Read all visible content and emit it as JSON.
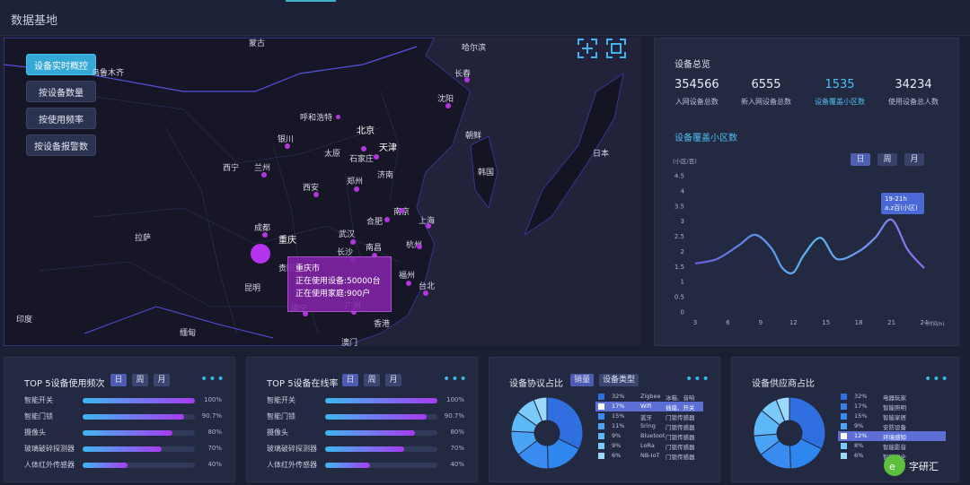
{
  "header": {
    "title": "数据基地"
  },
  "map": {
    "buttons": [
      "设备实时概控",
      "按设备数量",
      "按使用频率",
      "按设备报警数"
    ],
    "active_button_index": 0,
    "icons": [
      "scan-frame-icon",
      "fullscreen-icon"
    ],
    "cities": [
      {
        "name": "蒙古",
        "big": false
      },
      {
        "name": "乌鲁木齐",
        "big": false
      },
      {
        "name": "哈尔滨",
        "big": false
      },
      {
        "name": "长春",
        "big": false
      },
      {
        "name": "沈阳",
        "big": false
      },
      {
        "name": "呼和浩特",
        "big": false
      },
      {
        "name": "北京",
        "big": true
      },
      {
        "name": "朝鲜",
        "big": false
      },
      {
        "name": "韩国",
        "big": false
      },
      {
        "name": "日本",
        "big": false
      },
      {
        "name": "银川",
        "big": false
      },
      {
        "name": "太原",
        "big": false
      },
      {
        "name": "石家庄",
        "big": false
      },
      {
        "name": "天津",
        "big": true
      },
      {
        "name": "西宁",
        "big": false
      },
      {
        "name": "兰州",
        "big": false
      },
      {
        "name": "济南",
        "big": false
      },
      {
        "name": "西安",
        "big": false
      },
      {
        "name": "郑州",
        "big": false
      },
      {
        "name": "南京",
        "big": false
      },
      {
        "name": "合肥",
        "big": false
      },
      {
        "name": "上海",
        "big": false
      },
      {
        "name": "成都",
        "big": false
      },
      {
        "name": "重庆",
        "big": true
      },
      {
        "name": "武汉",
        "big": false
      },
      {
        "name": "杭州",
        "big": false
      },
      {
        "name": "拉萨",
        "big": false
      },
      {
        "name": "长沙",
        "big": false
      },
      {
        "name": "南昌",
        "big": false
      },
      {
        "name": "贵阳",
        "big": false
      },
      {
        "name": "福州",
        "big": false
      },
      {
        "name": "台北",
        "big": false
      },
      {
        "name": "昆明",
        "big": false
      },
      {
        "name": "广州",
        "big": false
      },
      {
        "name": "南宁",
        "big": false
      },
      {
        "name": "印度",
        "big": false
      },
      {
        "name": "缅甸",
        "big": false
      },
      {
        "name": "香港",
        "big": false
      },
      {
        "name": "澳门",
        "big": false
      }
    ],
    "tooltip": {
      "city": "重庆市",
      "line1": "正在使用设备:50000台",
      "line2": "正在使用家庭:900户"
    }
  },
  "overview": {
    "title": "设备总览",
    "stats": [
      {
        "value": "354566",
        "label": "入网设备总数",
        "highlight": false
      },
      {
        "value": "6555",
        "label": "新入网设备总数",
        "highlight": false
      },
      {
        "value": "1535",
        "label": "设备覆盖小区数",
        "highlight": true
      },
      {
        "value": "34234",
        "label": "使用设备总人数",
        "highlight": false
      }
    ],
    "coverage_title": "设备覆盖小区数",
    "periods": [
      "日",
      "周",
      "月"
    ],
    "active_period_index": 0,
    "tooltip": {
      "line1": "19-21h",
      "line2": "a.z百(小区)"
    }
  },
  "chart_data": {
    "type": "line",
    "ylabel": "(小区/百)",
    "xlabel": "(时间/h)",
    "x_ticks": [
      3,
      6,
      9,
      12,
      15,
      18,
      21,
      24
    ],
    "y_ticks": [
      0,
      0.5,
      1,
      1.5,
      2,
      2.5,
      3,
      3.5,
      4,
      4.5
    ],
    "ylim": [
      0,
      4.5
    ],
    "xlim": [
      3,
      24
    ],
    "series": [
      {
        "x": [
          3,
          5,
          7,
          8.5,
          10,
          11,
          12,
          13,
          14.5,
          16,
          18,
          19.5,
          21,
          22.5,
          24
        ],
        "values": [
          1.6,
          1.75,
          2.2,
          2.55,
          2.1,
          1.45,
          1.3,
          1.9,
          2.45,
          1.75,
          2.0,
          2.45,
          3.05,
          2.05,
          1.45
        ]
      }
    ],
    "grid": true
  },
  "cards": {
    "top5_freq": {
      "title": "TOP 5设备使用频次",
      "tabs": [
        "日",
        "周",
        "月"
      ],
      "more": "•••",
      "rows": [
        {
          "name": "智能开关",
          "pct_label": "100%",
          "value": 100
        },
        {
          "name": "智能门锁",
          "pct_label": "90.7%",
          "value": 90.7
        },
        {
          "name": "摄像头",
          "pct_label": "80%",
          "value": 80
        },
        {
          "name": "玻璃破碎探测器",
          "pct_label": "70%",
          "value": 70
        },
        {
          "name": "人体红外传感器",
          "pct_label": "40%",
          "value": 40
        }
      ]
    },
    "top5_online": {
      "title": "TOP 5设备在线率",
      "tabs": [
        "日",
        "周",
        "月"
      ],
      "more": "•••",
      "rows": [
        {
          "name": "智能开关",
          "pct_label": "100%",
          "value": 100
        },
        {
          "name": "智能门锁",
          "pct_label": "90.7%",
          "value": 90.7
        },
        {
          "name": "摄像头",
          "pct_label": "80%",
          "value": 80
        },
        {
          "name": "玻璃破碎探测器",
          "pct_label": "70%",
          "value": 70
        },
        {
          "name": "人体红外传感器",
          "pct_label": "40%",
          "value": 40
        }
      ]
    },
    "protocol": {
      "title": "设备协议占比",
      "tabs": [
        "销量",
        "设备类型"
      ],
      "more": "•••",
      "legend": [
        {
          "pct": "32%",
          "name": "Zigbee",
          "vendor": "冰箱、音响",
          "color": "#2f6fe0",
          "hl": false
        },
        {
          "pct": "17%",
          "name": "Wifi",
          "vendor": "插座、开关",
          "color": "#ffffff",
          "hl": true
        },
        {
          "pct": "15%",
          "name": "蓝牙",
          "vendor": "门锁传感器",
          "color": "#3a8bf0",
          "hl": false
        },
        {
          "pct": "11%",
          "name": "Sring",
          "vendor": "门锁传感器",
          "color": "#4aa3f5",
          "hl": false
        },
        {
          "pct": "9%",
          "name": "Bluetoot",
          "vendor": "门锁传感器",
          "color": "#5db8f8",
          "hl": false
        },
        {
          "pct": "9%",
          "name": "LoRa",
          "vendor": "门锁传感器",
          "color": "#7ccaf9",
          "hl": false
        },
        {
          "pct": "6%",
          "name": "NB-IoT",
          "vendor": "门锁传感器",
          "color": "#9bd8fb",
          "hl": false
        }
      ]
    },
    "supplier": {
      "title": "设备供应商占比",
      "more": "•••",
      "legend": [
        {
          "pct": "32%",
          "name": "电器玩家",
          "color": "#2f6fe0",
          "hl": false
        },
        {
          "pct": "17%",
          "name": "智能照明",
          "color": "#3a7ee8",
          "hl": false
        },
        {
          "pct": "15%",
          "name": "智能家居",
          "color": "#3a8bf0",
          "hl": false
        },
        {
          "pct": "9%",
          "name": "安防设备",
          "color": "#4aa3f5",
          "hl": false
        },
        {
          "pct": "12%",
          "name": "环境感知",
          "color": "#ffffff",
          "hl": true
        },
        {
          "pct": "8%",
          "name": "智能影音",
          "color": "#7ccaf9",
          "hl": false
        },
        {
          "pct": "6%",
          "name": "智能安全",
          "color": "#9bd8fb",
          "hl": false
        }
      ]
    }
  },
  "watermark": "字研汇"
}
